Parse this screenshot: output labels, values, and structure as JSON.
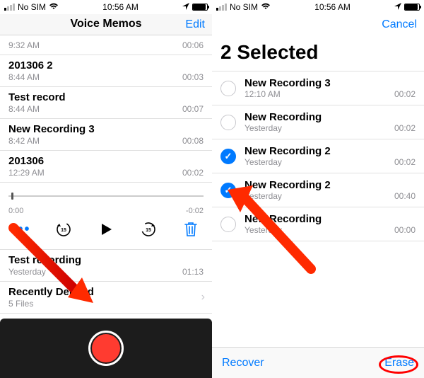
{
  "left": {
    "status": {
      "carrier": "No SIM",
      "wifi": true,
      "time": "10:56 AM",
      "batt_pct": 92
    },
    "nav": {
      "title": "Voice Memos",
      "edit": "Edit"
    },
    "partial_row": {
      "time": "9:32 AM",
      "dur": "00:06"
    },
    "rows": [
      {
        "title": "201306 2",
        "time": "8:44 AM",
        "dur": "00:03"
      },
      {
        "title": "Test record",
        "time": "8:44 AM",
        "dur": "00:07"
      },
      {
        "title": "New Recording 3",
        "time": "8:42 AM",
        "dur": "00:08"
      },
      {
        "title": "201306",
        "time": "12:29 AM",
        "dur": "00:02"
      }
    ],
    "player": {
      "t0": "0:00",
      "t1": "-0:02"
    },
    "below": {
      "row": {
        "title": "Test recording",
        "time": "Yesterday",
        "dur": "01:13"
      },
      "recently": {
        "title": "Recently Deleted",
        "sub": "5 Files"
      }
    }
  },
  "right": {
    "status": {
      "carrier": "No SIM",
      "wifi": true,
      "time": "10:56 AM",
      "batt_pct": 92
    },
    "nav": {
      "cancel": "Cancel"
    },
    "big_title": "2 Selected",
    "rows": [
      {
        "title": "New Recording 3",
        "time": "12:10 AM",
        "dur": "00:02",
        "checked": false
      },
      {
        "title": "New Recording",
        "time": "Yesterday",
        "dur": "00:02",
        "checked": false
      },
      {
        "title": "New Recording 2",
        "time": "Yesterday",
        "dur": "00:02",
        "checked": true
      },
      {
        "title": "New Recording 2",
        "time": "Yesterday",
        "dur": "00:40",
        "checked": true
      },
      {
        "title": "New Recording",
        "time": "Yesterday",
        "dur": "00:00",
        "checked": false
      }
    ],
    "toolbar": {
      "recover": "Recover",
      "erase": "Erase"
    }
  },
  "colors": {
    "tint": "#007aff",
    "red": "#ff3b30"
  }
}
